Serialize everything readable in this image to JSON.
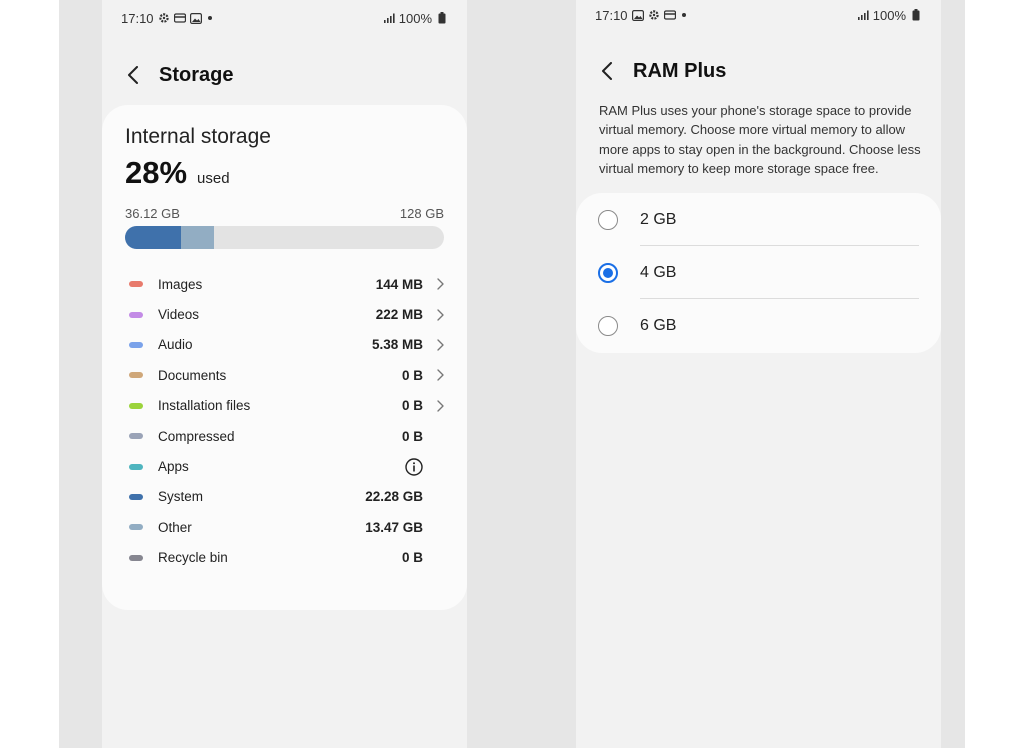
{
  "left_screen": {
    "status_bar": {
      "time": "17:10",
      "battery": "100%"
    },
    "title": "Storage",
    "internal_storage": {
      "label": "Internal storage",
      "percent": "28%",
      "percent_suffix": "used",
      "used_label": "36.12 GB",
      "total_label": "128 GB",
      "bar": [
        {
          "name": "System",
          "fraction": 0.174,
          "color": "#3f71ab"
        },
        {
          "name": "Other",
          "fraction": 0.105,
          "color": "#92adc3"
        }
      ]
    },
    "categories": [
      {
        "name": "Images",
        "size": "144 MB",
        "color": "#e87a6c",
        "chevron": true
      },
      {
        "name": "Videos",
        "size": "222 MB",
        "color": "#c38be6",
        "chevron": true
      },
      {
        "name": "Audio",
        "size": "5.38 MB",
        "color": "#7aa2ea",
        "chevron": true
      },
      {
        "name": "Documents",
        "size": "0 B",
        "color": "#cfa779",
        "chevron": true
      },
      {
        "name": "Installation files",
        "size": "0 B",
        "color": "#9bd33b",
        "chevron": true
      },
      {
        "name": "Compressed",
        "size": "0 B",
        "color": "#9aa3b7",
        "chevron": false
      },
      {
        "name": "Apps",
        "size": "",
        "color": "#4fb5bf",
        "chevron": false,
        "info": true
      },
      {
        "name": "System",
        "size": "22.28 GB",
        "color": "#3f71ab",
        "chevron": false
      },
      {
        "name": "Other",
        "size": "13.47 GB",
        "color": "#92adc3",
        "chevron": false
      },
      {
        "name": "Recycle bin",
        "size": "0 B",
        "color": "#868690",
        "chevron": false
      }
    ],
    "icons": {
      "back": "chevron-left-icon",
      "more": "chevron-right-icon",
      "info": "info-circle-icon"
    }
  },
  "right_screen": {
    "status_bar": {
      "time": "17:10",
      "battery": "100%"
    },
    "title": "RAM Plus",
    "description": "RAM Plus uses your phone's storage space to provide virtual memory. Choose more virtual memory to allow more apps to stay open in the background. Choose less virtual memory to keep more storage space free.",
    "options": [
      {
        "label": "2 GB",
        "selected": false
      },
      {
        "label": "4 GB",
        "selected": true
      },
      {
        "label": "6 GB",
        "selected": false
      }
    ],
    "accent_color": "#1a6fe6"
  }
}
